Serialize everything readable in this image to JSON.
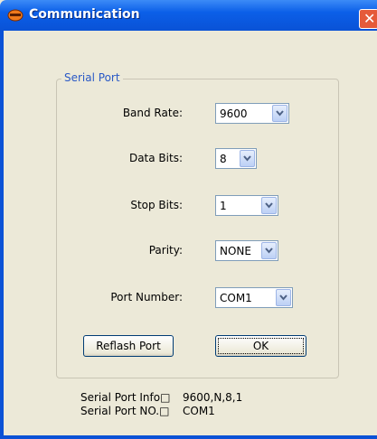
{
  "window": {
    "title": "Communication"
  },
  "serial_port_group": {
    "label": "Serial Port"
  },
  "fields": {
    "band_rate": {
      "label": "Band Rate:",
      "value": "9600"
    },
    "data_bits": {
      "label": "Data Bits:",
      "value": "8"
    },
    "stop_bits": {
      "label": "Stop Bits:",
      "value": "1"
    },
    "parity": {
      "label": "Parity:",
      "value": "NONE"
    },
    "port_number": {
      "label": "Port Number:",
      "value": "COM1"
    }
  },
  "buttons": {
    "reflash_port": "Reflash Port",
    "ok": "OK"
  },
  "info": {
    "serial_port_info_label": "Serial Port Info□",
    "serial_port_info_value": "9600,N,8,1",
    "serial_port_no_label": "Serial Port NO.□",
    "serial_port_no_value": "COM1"
  },
  "colors": {
    "titlebar": "#0a52d6",
    "group_label": "#2a59c6",
    "window_bg": "#ece9d8"
  },
  "icons": {
    "title_icon": "app-icon",
    "close": "close-icon",
    "dropdown": "chevron-down-icon"
  }
}
